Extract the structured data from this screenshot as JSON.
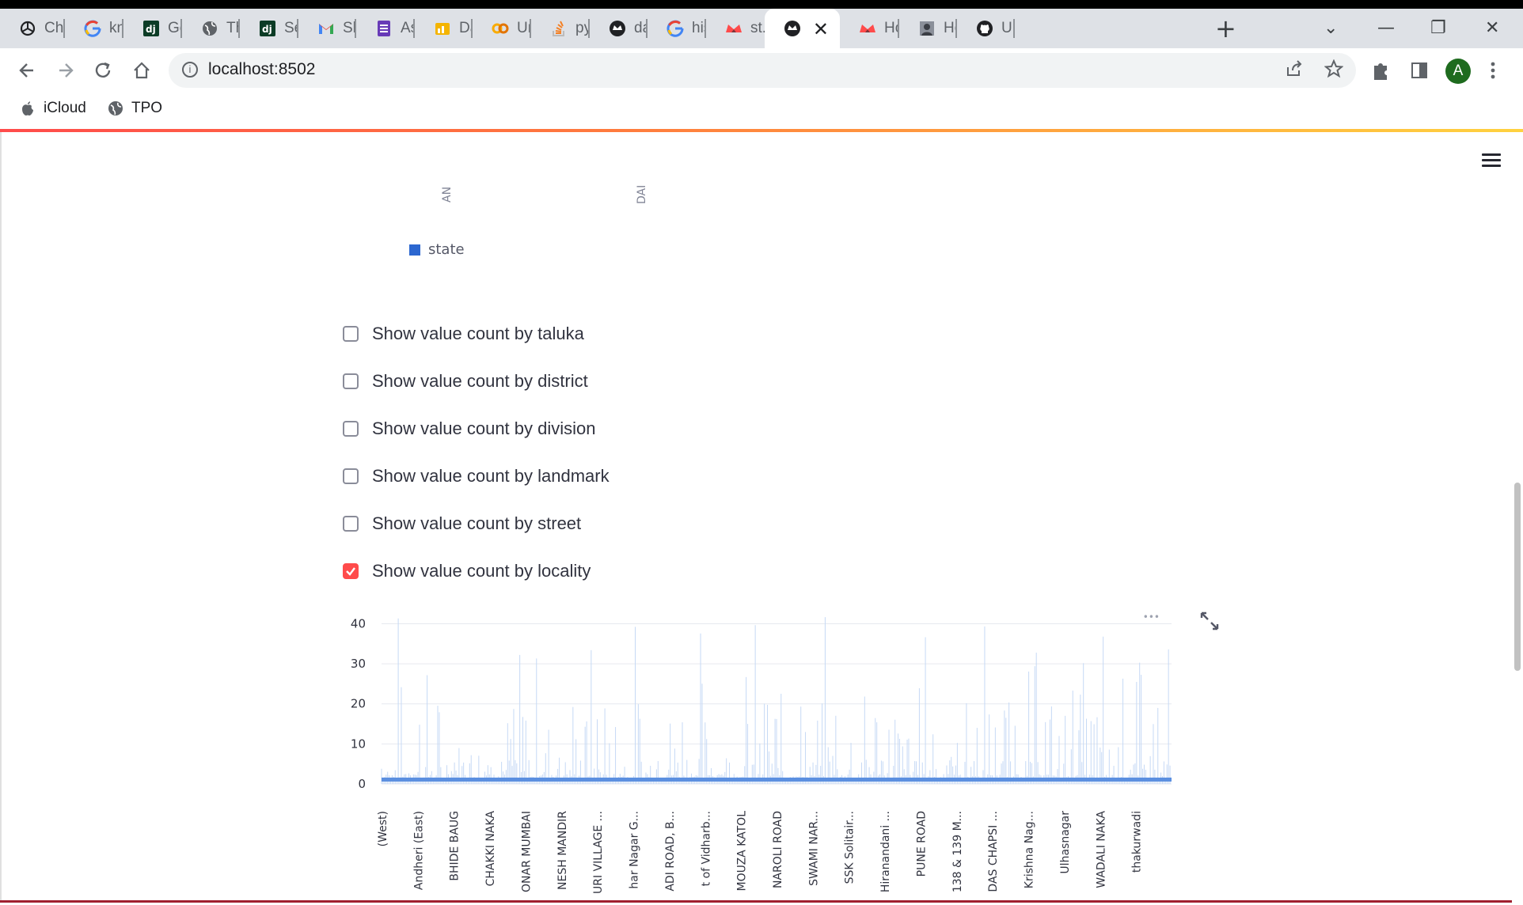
{
  "browser": {
    "tabs": [
      {
        "label": "ChatGPT",
        "icon": "openai-icon"
      },
      {
        "label": "knn",
        "icon": "google-icon"
      },
      {
        "label": "Get",
        "icon": "django-icon"
      },
      {
        "label": "This",
        "icon": "globe-icon"
      },
      {
        "label": "Sett",
        "icon": "django-icon"
      },
      {
        "label": "Sho",
        "icon": "gmail-icon"
      },
      {
        "label": "Ass",
        "icon": "forms-icon"
      },
      {
        "label": "Dat",
        "icon": "datasets-icon"
      },
      {
        "label": "Unt",
        "icon": "colab-icon"
      },
      {
        "label": "pyth",
        "icon": "stackoverflow-icon"
      },
      {
        "label": "data",
        "icon": "streamlit-icon"
      },
      {
        "label": "hist",
        "icon": "google-icon"
      },
      {
        "label": "st.p",
        "icon": "streamlit-crown-icon"
      },
      {
        "label": "",
        "icon": "streamlit-icon",
        "active": true
      },
      {
        "label": "How",
        "icon": "streamlit-crown-icon"
      },
      {
        "label": "How",
        "icon": "portrait-icon"
      },
      {
        "label": "Upl",
        "icon": "github-icon"
      }
    ],
    "close_tab_glyph": "✕",
    "new_tab_glyph": "+",
    "window_controls": {
      "dropdown": "⌄",
      "minimize": "—",
      "restore": "❐",
      "close": "✕"
    },
    "url": "localhost:8502",
    "profile_initial": "A",
    "bookmarks": [
      {
        "label": "iCloud",
        "icon": "apple-icon"
      },
      {
        "label": "TPO",
        "icon": "globe-icon"
      }
    ]
  },
  "previous_chart": {
    "x_tick_labels": [
      "AN",
      "DAI"
    ],
    "legend_label": "state",
    "legend_color": "#2c67d0"
  },
  "checkboxes": [
    {
      "label": "Show value count by taluka",
      "checked": false
    },
    {
      "label": "Show value count by district",
      "checked": false
    },
    {
      "label": "Show value count by division",
      "checked": false
    },
    {
      "label": "Show value count by landmark",
      "checked": false
    },
    {
      "label": "Show value count by street",
      "checked": false
    },
    {
      "label": "Show value count by locality",
      "checked": true
    }
  ],
  "colors": {
    "accent": "#ff4b4b",
    "bar": "#5b8fe0",
    "bar_faint": "#c6d9f5"
  },
  "chart_data": {
    "type": "bar",
    "title": "",
    "xlabel": "",
    "ylabel": "",
    "ylim": [
      0,
      42
    ],
    "y_ticks": [
      0,
      10,
      20,
      30,
      40
    ],
    "grid": true,
    "x_tick_labels": [
      "(West)",
      "Andheri (East)",
      "BHIDE BAUG",
      "CHAKKI NAKA",
      "ONAR MUMBAI",
      "NESH MANDIR",
      "URI VILLAGE ...",
      "har Nagar G...",
      "ADI ROAD, B...",
      "t of Vidharb...",
      "MOUZA KATOL",
      "NAROLI ROAD",
      "SWAMI NAR...",
      "SSK Solitair...",
      "Hiranandani ...",
      "PUNE ROAD",
      "138 & 139 M...",
      "DAS CHAPSI ...",
      "Krishna Nag...",
      "Ulhasnagar",
      "WADALI NAKA",
      "thakurwadi"
    ],
    "baseline_value": 1,
    "notes": "Dense bar chart of value counts per locality; most localities have count 1 with sparse spikes up to ~42."
  },
  "chart_toolbar": {
    "more_glyph": "•••"
  }
}
